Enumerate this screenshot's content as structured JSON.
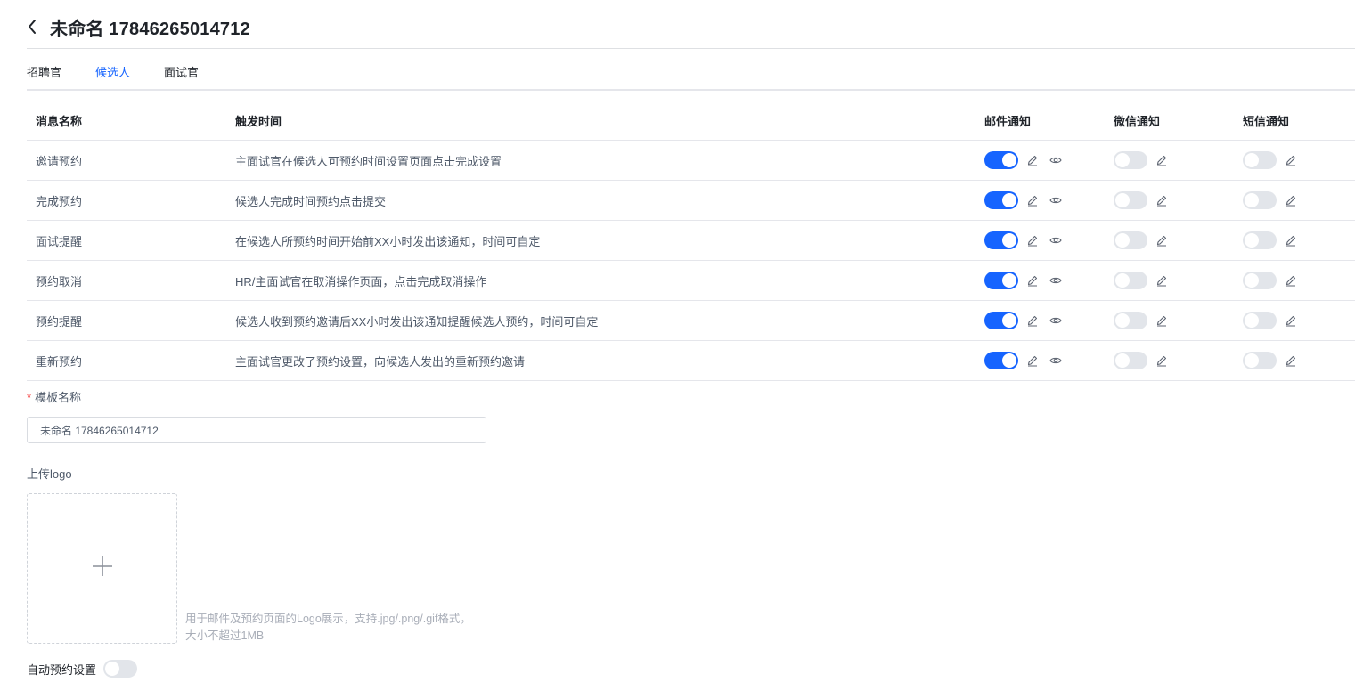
{
  "header": {
    "title": "未命名 17846265014712"
  },
  "tabs": [
    {
      "label": "招聘官",
      "active": false
    },
    {
      "label": "候选人",
      "active": true
    },
    {
      "label": "面试官",
      "active": false
    }
  ],
  "table": {
    "columns": {
      "name": "消息名称",
      "trigger": "触发时间",
      "email": "邮件通知",
      "wechat": "微信通知",
      "sms": "短信通知"
    },
    "rows": [
      {
        "name": "邀请预约",
        "trigger": "主面试官在候选人可预约时间设置页面点击完成设置",
        "email_on": true,
        "wechat_on": false,
        "sms_on": false
      },
      {
        "name": "完成预约",
        "trigger": "候选人完成时间预约点击提交",
        "email_on": true,
        "wechat_on": false,
        "sms_on": false
      },
      {
        "name": "面试提醒",
        "trigger": "在候选人所预约时间开始前XX小时发出该通知，时间可自定",
        "email_on": true,
        "wechat_on": false,
        "sms_on": false
      },
      {
        "name": "预约取消",
        "trigger": "HR/主面试官在取消操作页面，点击完成取消操作",
        "email_on": true,
        "wechat_on": false,
        "sms_on": false
      },
      {
        "name": "预约提醒",
        "trigger": "候选人收到预约邀请后XX小时发出该通知提醒候选人预约，时间可自定",
        "email_on": true,
        "wechat_on": false,
        "sms_on": false
      },
      {
        "name": "重新预约",
        "trigger": "主面试官更改了预约设置，向候选人发出的重新预约邀请",
        "email_on": true,
        "wechat_on": false,
        "sms_on": false
      }
    ]
  },
  "form": {
    "template_name_label": "模板名称",
    "required_mark": "*",
    "template_name_value": "未命名 17846265014712",
    "upload_logo_label": "上传logo",
    "upload_hint": "用于邮件及预约页面的Logo展示，支持.jpg/.png/.gif格式，大小不超过1MB",
    "auto_booking_label": "自动预约设置",
    "auto_booking_on": false
  },
  "colors": {
    "accent": "#1664ff",
    "switch_off": "#e2e5ea",
    "required": "#f53f3f"
  },
  "icons": [
    "back-arrow-icon",
    "edit-pencil-icon",
    "preview-eye-icon",
    "plus-icon"
  ]
}
